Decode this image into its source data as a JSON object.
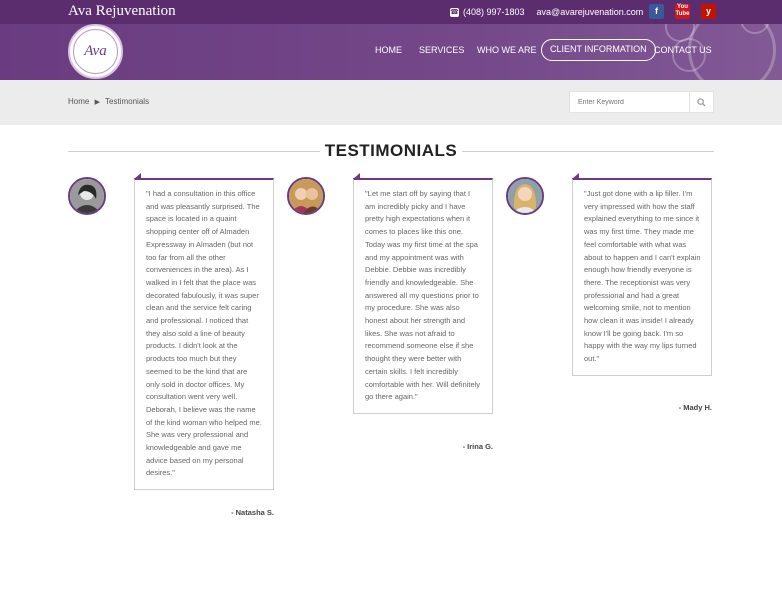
{
  "header": {
    "brand": "Ava Rejuvenation",
    "phone": "(408) 997-1803",
    "email": "ava@avarejuvenation.com",
    "social": {
      "facebook": "f",
      "youtube": "You Tube",
      "yelp": "y"
    },
    "logo_text": "Ava"
  },
  "nav": [
    {
      "label": "HOME"
    },
    {
      "label": "SERVICES"
    },
    {
      "label": "WHO WE ARE"
    },
    {
      "label": "CLIENT INFORMATION"
    },
    {
      "label": "CONTACT US"
    }
  ],
  "breadcrumb": {
    "home": "Home",
    "current": "Testimonials"
  },
  "search": {
    "placeholder": "Enter Keyword"
  },
  "page_title": "TESTIMONIALS",
  "testimonials": [
    {
      "quote": "\"I had a consultation in this office and was pleasantly surprised.  The space is located in a quaint shopping center off of Almaden Expressway in Almaden (but not too far from all the other conveniences in the area).  As I walked in I felt that the place was decorated fabulously, it was super clean and the service felt caring and professional.  I noticed that they also sold a line of beauty products. I didn't look at the products too much but they seemed to be the kind that are only sold in doctor offices. My consultation went very well.  Deborah, I believe was the name of the kind woman who helped me.  She was very professional and knowledgeable and gave me advice based on my personal desires.\"",
      "author": "- Natasha S."
    },
    {
      "quote": "\"Let me start off by saying that I am incredibly picky and I have pretty high expectations when it comes to places like this one. Today was my first time at the spa and my appointment was with Debbie. Debbie was incredibly friendly and knowledgeable. She answered all my questions prior to my procedure. She was also honest about her strength and likes. She was not afraid to recommend someone else if she thought they were better with certain skills. I felt incredibly comfortable with her.  Will definitely go there again.\"",
      "author": "- Irina G."
    },
    {
      "quote": "\"Just got done with a lip filler. I'm very impressed with how the staff explained everything to me since it was my first time. They made me feel comfortable with what was about to happen and I can't explain enough how friendly everyone is there. The receptionist was very professional and had a great welcoming smile, not to mention how clean it was inside! I already know I'll be going back. I'm so happy with the way my lips turned out.\"",
      "author": "- Mady H."
    }
  ],
  "colors": {
    "brand_purple": "#5b2d6f",
    "nav_purple": "#6a3b80"
  }
}
